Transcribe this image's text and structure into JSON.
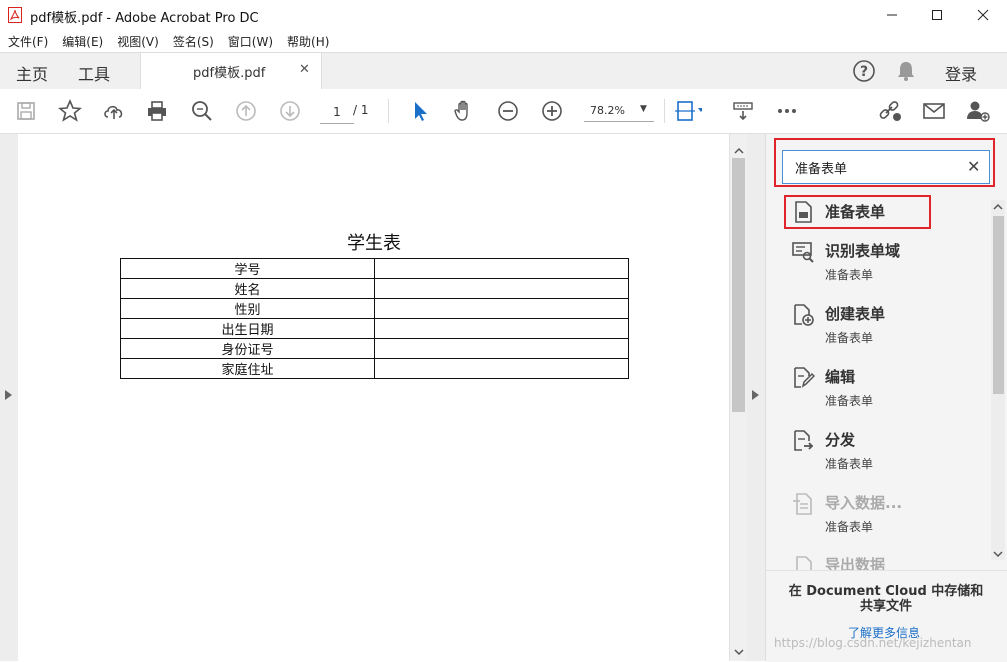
{
  "window": {
    "title": "pdf模板.pdf - Adobe Acrobat Pro DC"
  },
  "menu": [
    "文件(F)",
    "编辑(E)",
    "视图(V)",
    "签名(S)",
    "窗口(W)",
    "帮助(H)"
  ],
  "tabs": {
    "home": "主页",
    "tools": "工具",
    "document": "pdf模板.pdf",
    "login": "登录"
  },
  "toolbar": {
    "page_current": "1",
    "page_total": "/ 1",
    "zoom": "78.2%"
  },
  "document": {
    "title": "学生表",
    "rows": [
      "学号",
      "姓名",
      "性别",
      "出生日期",
      "身份证号",
      "家庭住址"
    ]
  },
  "search": {
    "value": "准备表单"
  },
  "results": [
    {
      "title": "准备表单",
      "subtitle": "",
      "icon": "prepare-form-icon",
      "enabled": true
    },
    {
      "title": "识别表单域",
      "subtitle": "准备表单",
      "icon": "identify-fields-icon",
      "enabled": true
    },
    {
      "title": "创建表单",
      "subtitle": "准备表单",
      "icon": "create-form-icon",
      "enabled": true
    },
    {
      "title": "编辑",
      "subtitle": "准备表单",
      "icon": "edit-form-icon",
      "enabled": true
    },
    {
      "title": "分发",
      "subtitle": "准备表单",
      "icon": "distribute-icon",
      "enabled": true
    },
    {
      "title": "导入数据...",
      "subtitle": "准备表单",
      "icon": "import-data-icon",
      "enabled": false
    },
    {
      "title": "导出数据",
      "subtitle": "",
      "icon": "export-data-icon",
      "enabled": false
    }
  ],
  "footer": {
    "cloud_text": "在 Document Cloud 中存储和共享文件",
    "learn_more": "了解更多信息",
    "watermark": "https://blog.csdn.net/kejizhentan"
  },
  "colors": {
    "accent": "#1a6fc9",
    "highlight": "#e0242b",
    "acrobat_red": "#d9251d"
  }
}
